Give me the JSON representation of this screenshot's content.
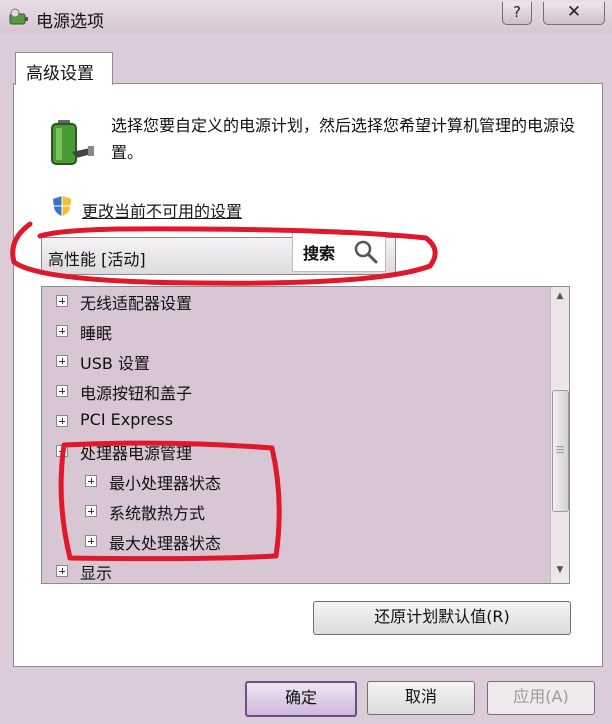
{
  "window": {
    "title": "电源选项",
    "help_glyph": "?",
    "close_glyph": "✕"
  },
  "tabs": [
    {
      "label": "高级设置"
    }
  ],
  "description": "选择您要自定义的电源计划，然后选择您希望计算机管理的电源设置。",
  "change_link": "更改当前不可用的设置",
  "plan_select": {
    "value": "高性能 [活动]"
  },
  "search": {
    "label": "搜索"
  },
  "tree": {
    "items": [
      {
        "label": "无线适配器设置"
      },
      {
        "label": "睡眠"
      },
      {
        "label": "USB 设置"
      },
      {
        "label": "电源按钮和盖子"
      },
      {
        "label": "PCI Express"
      },
      {
        "label": "处理器电源管理"
      },
      {
        "label": "最小处理器状态"
      },
      {
        "label": "系统散热方式"
      },
      {
        "label": "最大处理器状态"
      },
      {
        "label": "显示"
      }
    ]
  },
  "buttons": {
    "restore": "还原计划默认值(R)",
    "ok": "确定",
    "cancel": "取消",
    "apply": "应用(A)"
  },
  "colors": {
    "annotation": "#e0182c",
    "window": "#dccbd8"
  }
}
